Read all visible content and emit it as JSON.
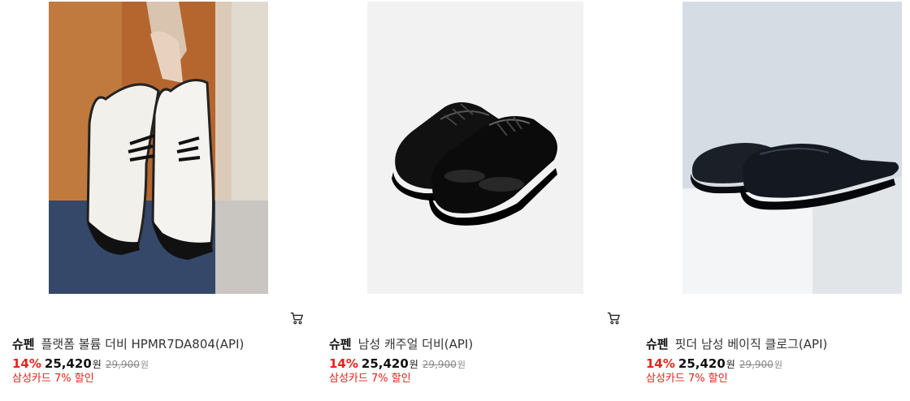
{
  "products": [
    {
      "brand": "슈펜",
      "name": "플랫폼 볼륨 더비 HPMR7DA804(API)",
      "discount": "14%",
      "price": "25,420",
      "price_unit": "원",
      "original_price": "29,900",
      "original_unit": "원",
      "card_benefit": "삼성카드 7% 할인",
      "image_icon": "white-derby-shoes-held-in-hand",
      "cart_icon": "cart-icon"
    },
    {
      "brand": "슈펜",
      "name": "남성 캐주얼 더비(API)",
      "discount": "14%",
      "price": "25,420",
      "price_unit": "원",
      "original_price": "29,900",
      "original_unit": "원",
      "card_benefit": "삼성카드 7% 할인",
      "image_icon": "black-glossy-derby-shoes",
      "cart_icon": "cart-icon"
    },
    {
      "brand": "슈펜",
      "name": "핏더 남성 베이직 클로그(API)",
      "discount": "14%",
      "price": "25,420",
      "price_unit": "원",
      "original_price": "29,900",
      "original_unit": "원",
      "card_benefit": "삼성카드 7% 할인",
      "image_icon": "black-leather-clogs-on-white-block"
    }
  ],
  "colors": {
    "discount": "#e2231a",
    "benefit": "#e2231a",
    "text": "#222222",
    "strike": "#888888"
  }
}
